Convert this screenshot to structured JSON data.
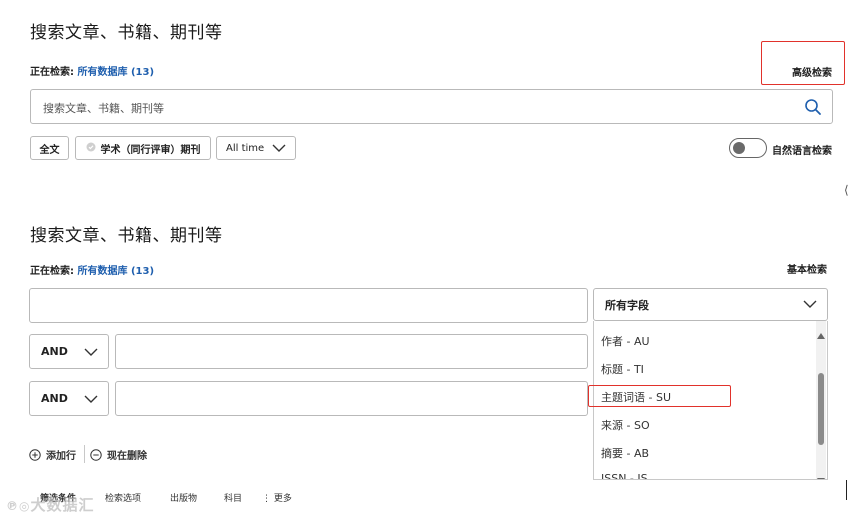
{
  "basic": {
    "title": "搜索文章、书籍、期刊等",
    "searching_prefix": "正在检索:",
    "searching_db": "所有数据库 (13)",
    "advanced_link": "高级检索",
    "search_placeholder": "搜索文章、书籍、期刊等",
    "filters": {
      "fulltext": "全文",
      "peer_reviewed": "学术（同行评审）期刊",
      "time": "All time"
    },
    "nl_toggle_label": "自然语言检索"
  },
  "advanced": {
    "title": "搜索文章、书籍、期刊等",
    "searching_prefix": "正在检索:",
    "searching_db": "所有数据库 (13)",
    "basic_link": "基本检索",
    "field_select_value": "所有字段",
    "rows": [
      {
        "operator": "AND"
      },
      {
        "operator": "AND"
      }
    ],
    "field_options": [
      "作者 - AU",
      "标题 - TI",
      "主题词语 - SU",
      "来源 - SO",
      "摘要 - AB",
      "ISSN - IS"
    ],
    "highlighted_option": "主题词语 - SU",
    "add_row": "添加行",
    "delete_row": "现在删除"
  },
  "bottom_tabs": [
    "筛选条件",
    "检索选项",
    "出版物",
    "科目",
    "更多"
  ],
  "watermark": "大数据汇",
  "colors": {
    "accent": "#1f5fae",
    "highlight": "#e1322b"
  },
  "icons": [
    "search-icon",
    "chevron-down-icon",
    "plus-circle-icon",
    "minus-circle-icon",
    "check-circle-icon",
    "scroll-up-icon",
    "scroll-down-icon"
  ]
}
